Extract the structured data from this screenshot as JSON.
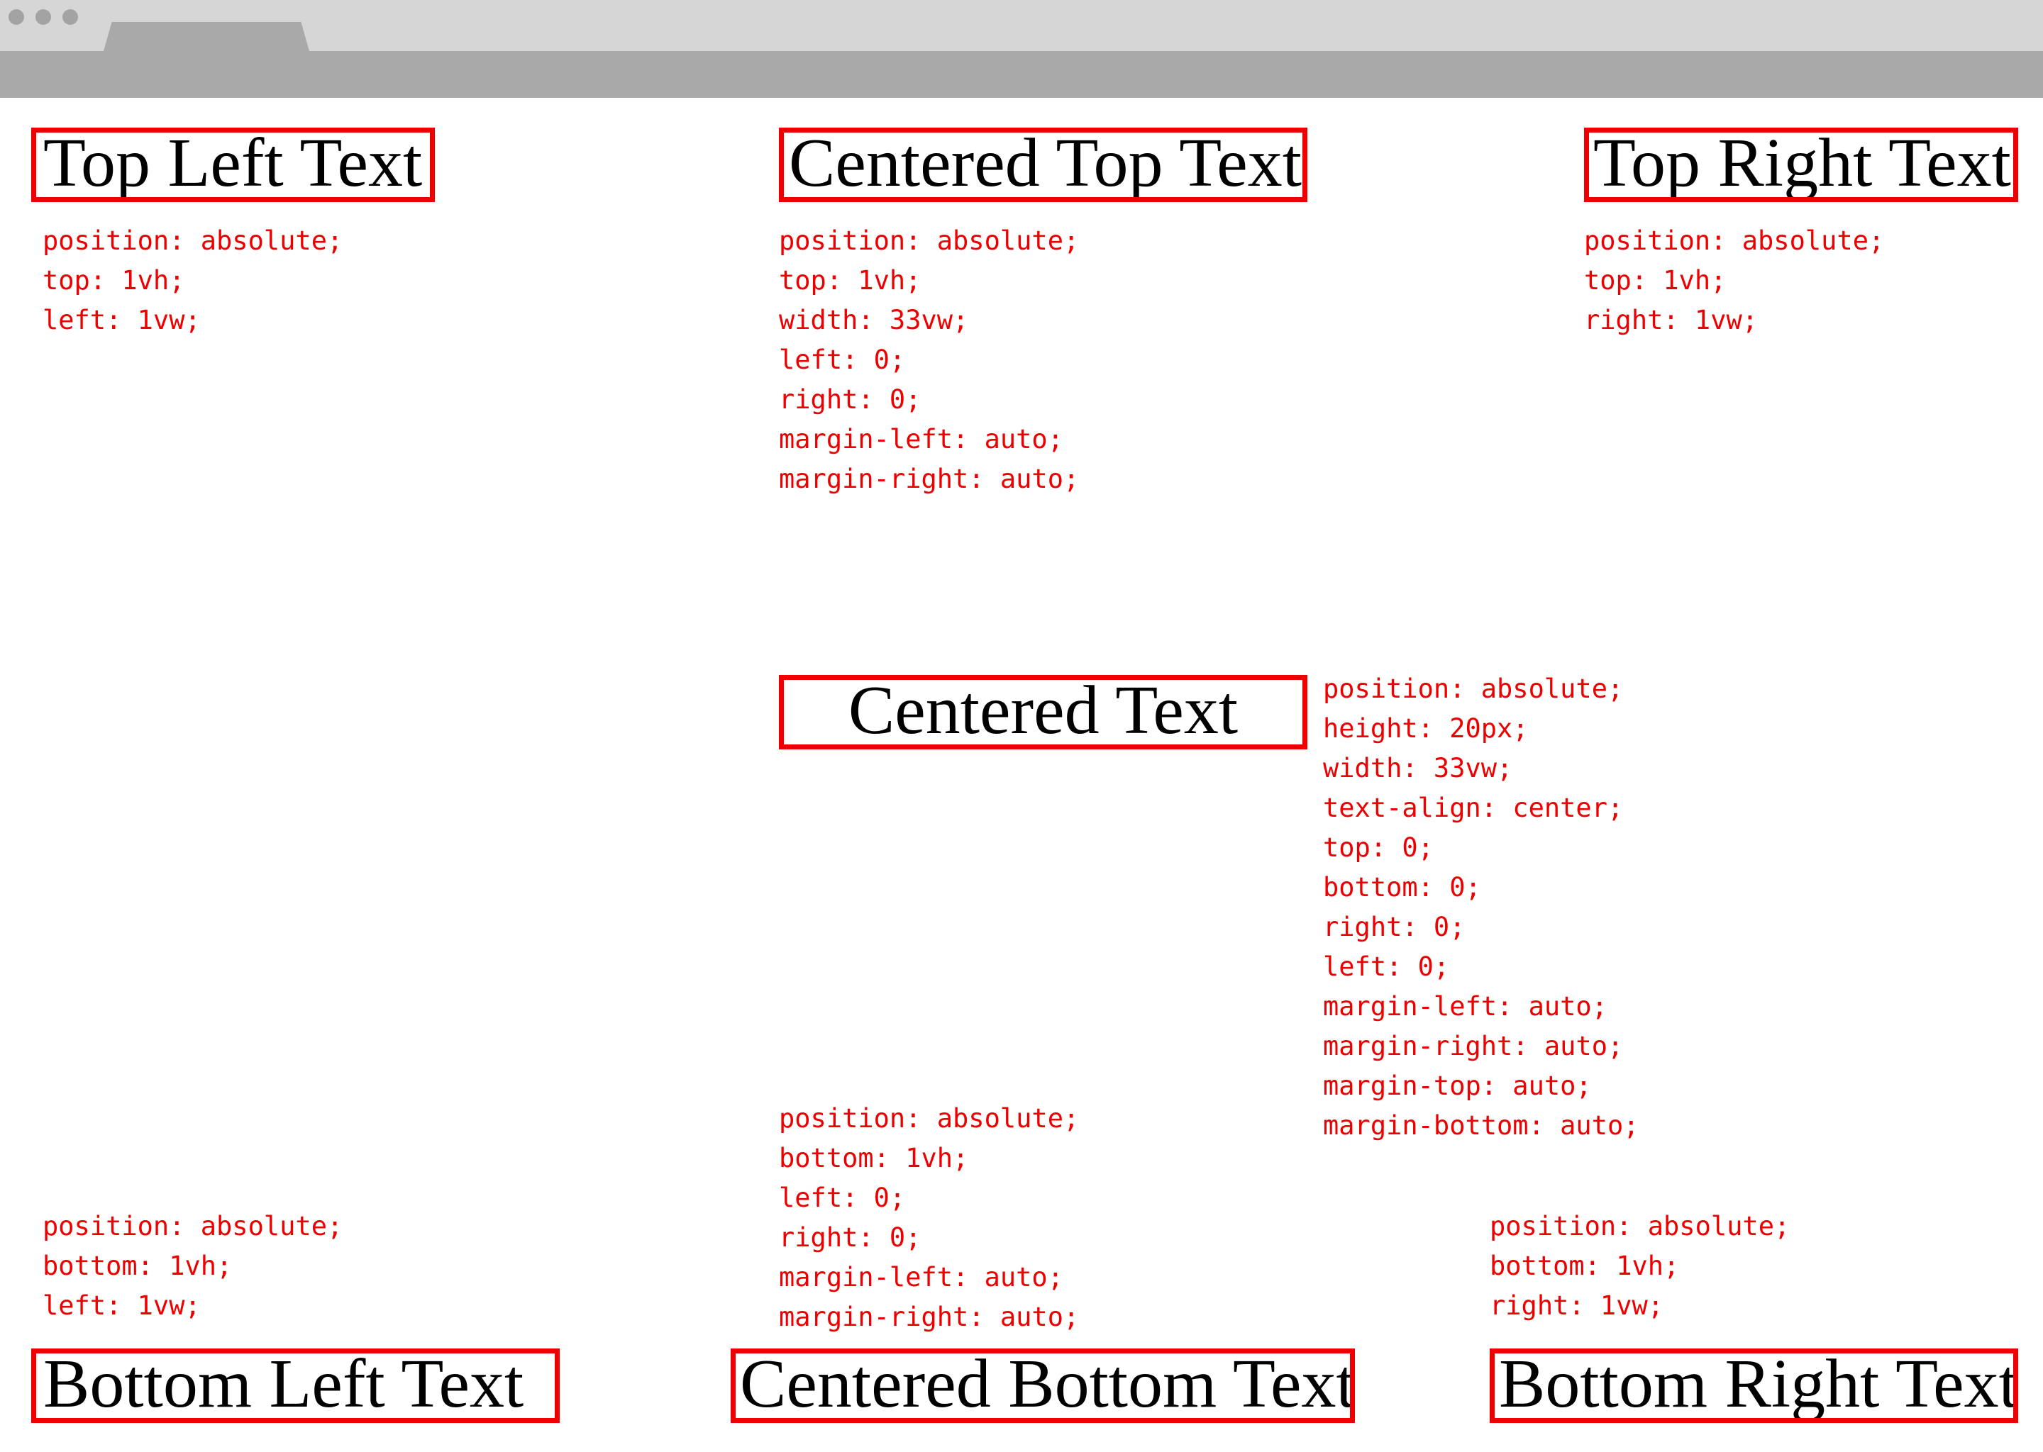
{
  "colors": {
    "chrome_light": "#d6d6d6",
    "chrome_dark": "#a9a9a9",
    "accent_red": "#ee0000",
    "text": "#000000",
    "background": "#ffffff"
  },
  "window_controls": {
    "icons": [
      "window-dot-icon",
      "window-dot-icon",
      "window-dot-icon"
    ]
  },
  "boxes": {
    "top_left": "Top Left Text",
    "top_center": "Centered Top Text",
    "top_right": "Top Right Text",
    "center": "Centered Text",
    "bottom_left": "Bottom Left Text",
    "bottom_center": "Centered Bottom Text",
    "bottom_right": "Bottom Right Text"
  },
  "css": {
    "top_left": [
      "position: absolute;",
      "top: 1vh;",
      "left: 1vw;"
    ],
    "top_center": [
      "position: absolute;",
      "top: 1vh;",
      "width: 33vw;",
      "left: 0;",
      "right: 0;",
      "margin-left: auto;",
      "margin-right: auto;"
    ],
    "top_right": [
      "position: absolute;",
      "top: 1vh;",
      "right: 1vw;"
    ],
    "center": [
      "position: absolute;",
      "height: 20px;",
      "width: 33vw;",
      "text-align: center;",
      "top: 0;",
      "bottom: 0;",
      "right: 0;",
      "left: 0;",
      "margin-left: auto;",
      "margin-right: auto;",
      "margin-top: auto;",
      "margin-bottom: auto;"
    ],
    "bottom_center": [
      "position: absolute;",
      "bottom: 1vh;",
      "left: 0;",
      "right: 0;",
      "margin-left: auto;",
      "margin-right: auto;"
    ],
    "bottom_left": [
      "position: absolute;",
      "bottom: 1vh;",
      "left: 1vw;"
    ],
    "bottom_right": [
      "position: absolute;",
      "bottom: 1vh;",
      "right: 1vw;"
    ]
  }
}
